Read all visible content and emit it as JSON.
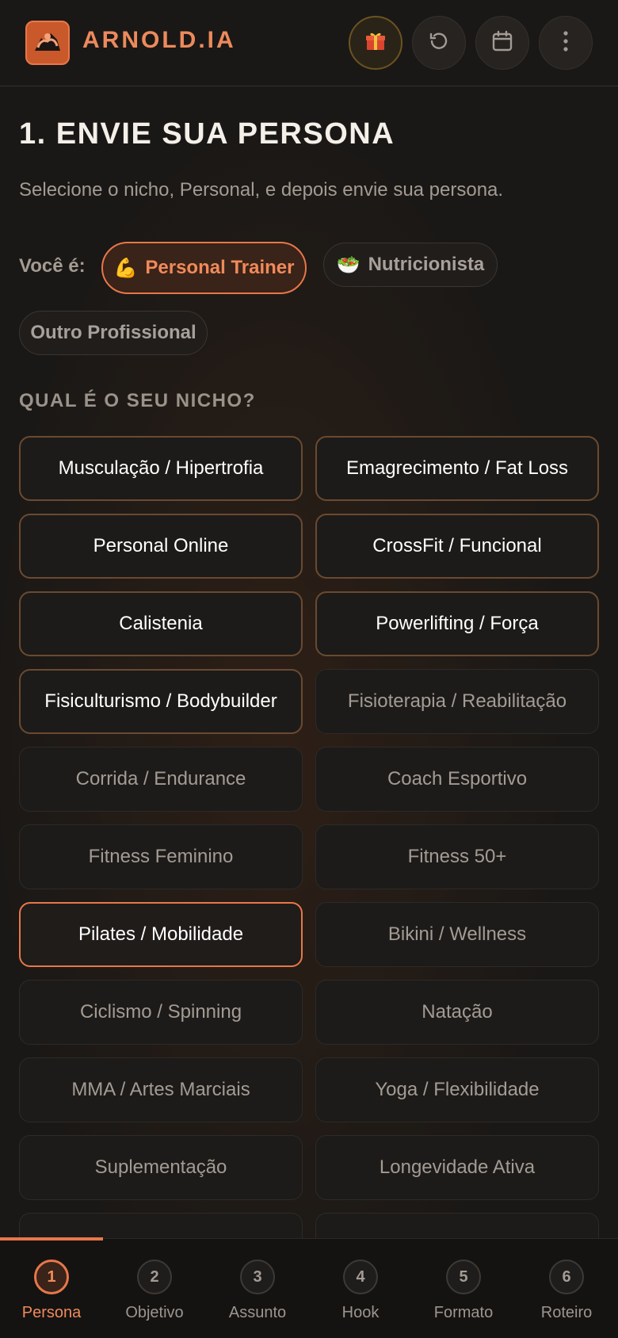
{
  "header": {
    "brand": "ARNOLD.IA",
    "icons": [
      "gift-icon",
      "history-icon",
      "calendar-icon",
      "more-vertical-icon"
    ],
    "accent": "#e8774a"
  },
  "main": {
    "title": "1. ENVIE SUA PERSONA",
    "subtitle": "Selecione o nicho, Personal, e depois envie sua persona.",
    "you_are_label": "Você é:",
    "roles": [
      {
        "emoji": "💪",
        "label": "Personal Trainer",
        "active": true
      },
      {
        "emoji": "🥗",
        "label": "Nutricionista",
        "active": false
      },
      {
        "emoji": "",
        "label": "Outro Profissional",
        "active": false
      }
    ],
    "niche_label": "QUAL É O SEU NICHO?",
    "niches": [
      {
        "label": "Musculação / Hipertrofia",
        "state": "highlighted"
      },
      {
        "label": "Emagrecimento / Fat Loss",
        "state": "highlighted"
      },
      {
        "label": "Personal Online",
        "state": "highlighted"
      },
      {
        "label": "CrossFit / Funcional",
        "state": "highlighted"
      },
      {
        "label": "Calistenia",
        "state": "highlighted"
      },
      {
        "label": "Powerlifting / Força",
        "state": "highlighted"
      },
      {
        "label": "Fisiculturismo / Bodybuilder",
        "state": "highlighted"
      },
      {
        "label": "Fisioterapia / Reabilitação",
        "state": "normal"
      },
      {
        "label": "Corrida / Endurance",
        "state": "normal"
      },
      {
        "label": "Coach Esportivo",
        "state": "normal"
      },
      {
        "label": "Fitness Feminino",
        "state": "normal"
      },
      {
        "label": "Fitness 50+",
        "state": "normal"
      },
      {
        "label": "Pilates / Mobilidade",
        "state": "selected"
      },
      {
        "label": "Bikini / Wellness",
        "state": "normal"
      },
      {
        "label": "Ciclismo / Spinning",
        "state": "normal"
      },
      {
        "label": "Natação",
        "state": "normal"
      },
      {
        "label": "MMA / Artes Marciais",
        "state": "normal"
      },
      {
        "label": "Yoga / Flexibilidade",
        "state": "normal"
      },
      {
        "label": "Suplementação",
        "state": "normal"
      },
      {
        "label": "Longevidade Ativa",
        "state": "normal"
      }
    ]
  },
  "steps": [
    {
      "num": "1",
      "label": "Persona",
      "active": true
    },
    {
      "num": "2",
      "label": "Objetivo",
      "active": false
    },
    {
      "num": "3",
      "label": "Assunto",
      "active": false
    },
    {
      "num": "4",
      "label": "Hook",
      "active": false
    },
    {
      "num": "5",
      "label": "Formato",
      "active": false
    },
    {
      "num": "6",
      "label": "Roteiro",
      "active": false
    }
  ]
}
